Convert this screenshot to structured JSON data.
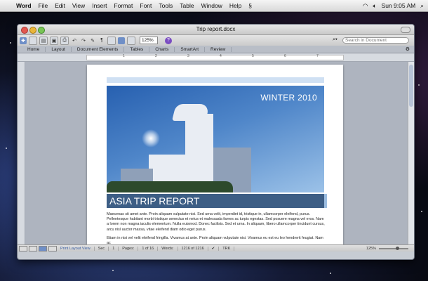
{
  "menubar": {
    "app": "Word",
    "items": [
      "File",
      "Edit",
      "View",
      "Insert",
      "Format",
      "Font",
      "Tools",
      "Table",
      "Window",
      "Help"
    ],
    "clock": "Sun 9:05 AM"
  },
  "window": {
    "title": "Trip report.docx",
    "zoom": "125%",
    "search_placeholder": "Search in Document"
  },
  "ribbon": {
    "tabs": [
      "Home",
      "Layout",
      "Document Elements",
      "Tables",
      "Charts",
      "SmartArt",
      "Review"
    ]
  },
  "ruler": {
    "ticks": [
      "1",
      "2",
      "3",
      "4",
      "5",
      "6",
      "7"
    ]
  },
  "document": {
    "photo_caption": "WINTER 2010",
    "banner_title": "ASIA TRIP REPORT",
    "paragraphs": [
      "Maecenas sit amet ante. Proin aliquam vulputate nisi. Sed urna velit, imperdiet id, tristique in, ullamcorper eleifend, purus. Pellentesque habitant morbi tristique senectus et netus et malesuada fames ac turpis egestas. Sed posuere magna vel eros. Nam a lorem non magna iaculis elementum. Nulla euismod. Donec facilisis. Sed et urna. In aliquam, libero ullamcorper tincidunt cursus, arcu nisl auctor massa, vitae eleifend diam odio eget purus.",
      "Etiam in nisi vel velit eleifend fringilla. Vivamus at ante. Proin aliquam vulputate nisi. Vivamus eu est eu leo hendrerit feugiat. Nam ac"
    ]
  },
  "statusbar": {
    "view_label": "Print Layout View",
    "sec_label": "Sec",
    "sec": "1",
    "pages_label": "Pages:",
    "pages": "1 of 16",
    "words_label": "Words:",
    "words": "1216 of 1216",
    "trk": "TRK",
    "zoom": "125%"
  }
}
